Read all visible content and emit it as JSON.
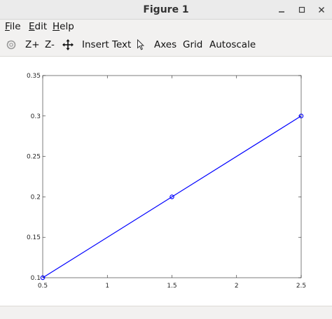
{
  "window": {
    "title": "Figure 1"
  },
  "menu": {
    "file": {
      "mnemonic": "F",
      "rest": "ile"
    },
    "edit": {
      "mnemonic": "E",
      "rest": "dit"
    },
    "help": {
      "mnemonic": "H",
      "rest": "elp"
    }
  },
  "toolbar": {
    "zoom_in": "Z+",
    "zoom_out": "Z-",
    "insert_text": "Insert Text",
    "axes": "Axes",
    "grid": "Grid",
    "autoscale": "Autoscale",
    "icons": [
      "rotate-icon",
      "pan-icon",
      "select-pointer-icon"
    ]
  },
  "chart_data": {
    "type": "line",
    "x": [
      0.5,
      1.5,
      2.5
    ],
    "series": [
      {
        "values": [
          0.1,
          0.2,
          0.3
        ],
        "color": "#0000ff",
        "marker": "circle"
      }
    ],
    "xlim": [
      0.5,
      2.5
    ],
    "ylim": [
      0.1,
      0.35
    ],
    "xticks": [
      "0.5",
      "1",
      "1.5",
      "2",
      "2.5"
    ],
    "yticks": [
      "0.1",
      "0.15",
      "0.2",
      "0.25",
      "0.3",
      "0.35"
    ],
    "grid": false
  }
}
